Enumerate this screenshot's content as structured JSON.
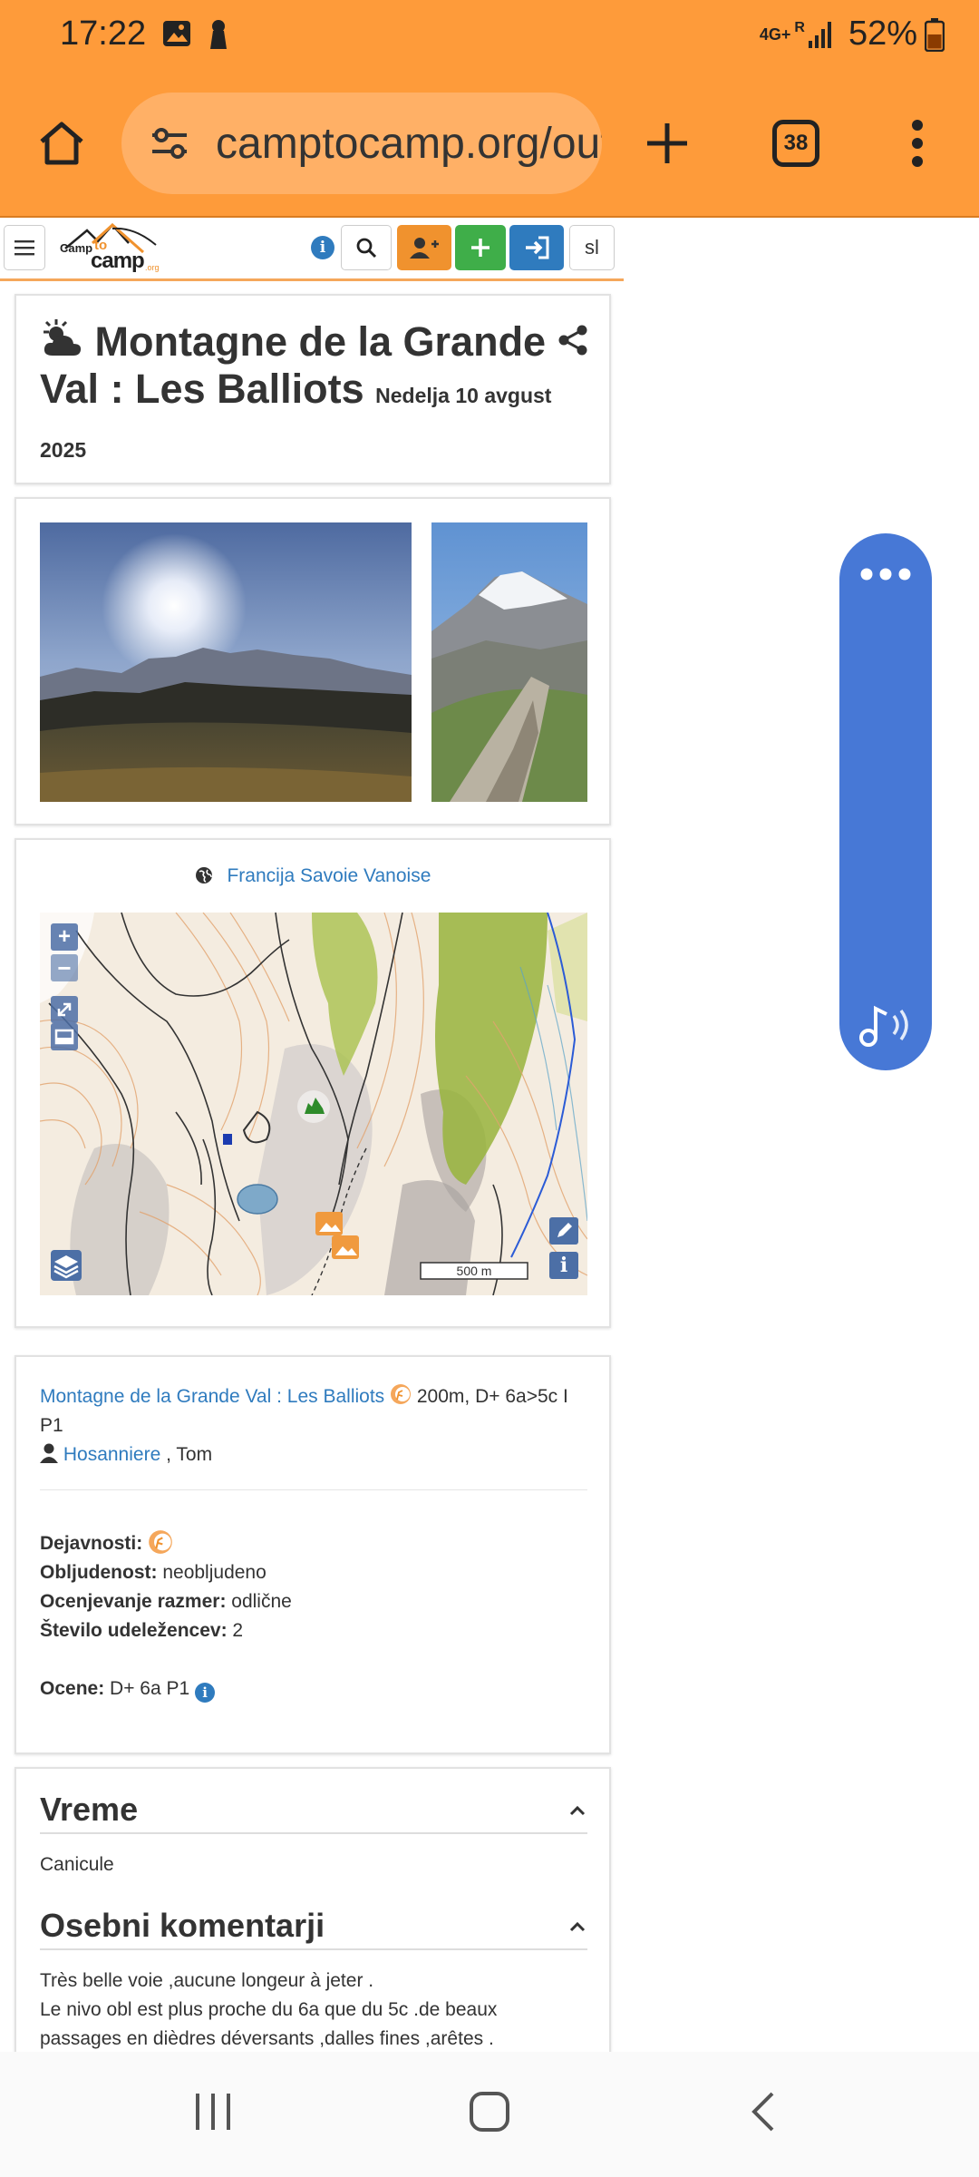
{
  "status_bar": {
    "time": "17:22",
    "network": "4G+",
    "roaming": "R",
    "battery": "52%"
  },
  "browser": {
    "url": "camptocamp.org/outings",
    "tab_count": "38"
  },
  "site_nav": {
    "logo_top": "Camp",
    "logo_mid": "to",
    "logo_bottom": "camp",
    "logo_org": ".org",
    "language": "sl"
  },
  "outing": {
    "title": "Montagne de la Grande Val : Les Balliots",
    "date": "Nedelja 10 avgust 2025"
  },
  "location": {
    "label": "Francija Savoie Vanoise"
  },
  "map": {
    "scale_label": "500 m"
  },
  "route": {
    "link_text": "Montagne de la Grande Val : Les Balliots",
    "details": "200m, D+ 6a>5c I P1",
    "participant_link": "Hosanniere",
    "participant_other": ", Tom"
  },
  "fields": {
    "activities_label": "Dejavnosti:",
    "frequentation_label": "Obljudenost:",
    "frequentation_value": "neobljudeno",
    "conditions_label": "Ocenjevanje razmer:",
    "conditions_value": "odlične",
    "participants_label": "Število udeležencev:",
    "participants_value": "2",
    "ratings_label": "Ocene:",
    "ratings_value": "D+ 6a P1"
  },
  "sections": {
    "weather_title": "Vreme",
    "weather_text": "Canicule",
    "comments_title": "Osebni komentarji",
    "comments_line1": "Très belle voie ,aucune longeur à jeter .",
    "comments_line2": "Le nivo obl est plus proche du 6a que du 5c .de beaux",
    "comments_line3": "passages en dièdres déversants ,dalles fines ,arêtes ."
  },
  "colors": {
    "browser_orange": "#FE9B3A",
    "link_blue": "#2F7BBE",
    "join_orange": "#F0922E",
    "add_green": "#3FAE49",
    "float_blue": "#4778D6"
  }
}
